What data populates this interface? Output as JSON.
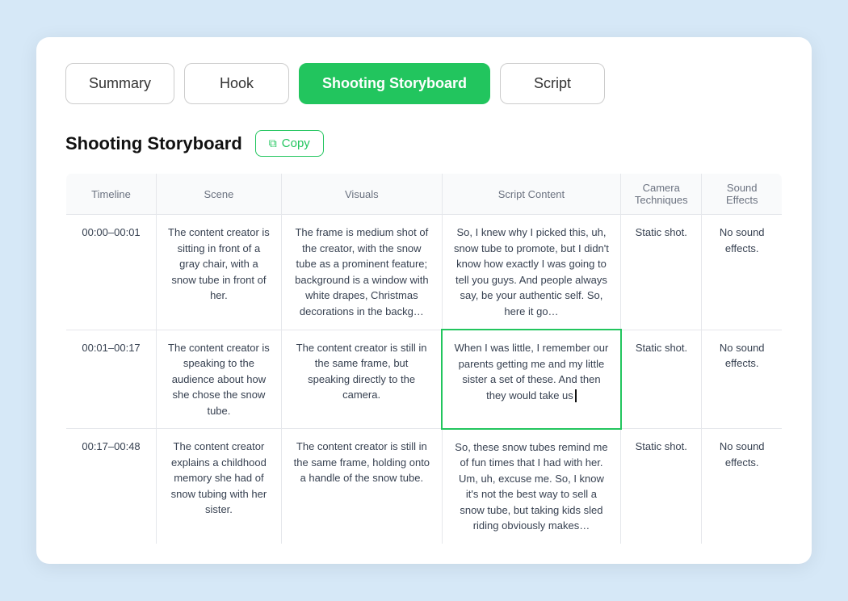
{
  "tabs": [
    {
      "id": "summary",
      "label": "Summary",
      "active": false
    },
    {
      "id": "hook",
      "label": "Hook",
      "active": false
    },
    {
      "id": "shooting-storyboard",
      "label": "Shooting Storyboard",
      "active": true
    },
    {
      "id": "script",
      "label": "Script",
      "active": false
    }
  ],
  "section": {
    "title": "Shooting Storyboard",
    "copy_label": "Copy"
  },
  "table": {
    "headers": [
      "Timeline",
      "Scene",
      "Visuals",
      "Script Content",
      "Camera\nTechniques",
      "Sound\nEffects"
    ],
    "rows": [
      {
        "timeline": "00:00–00:01",
        "scene": "The content creator is sitting in front of a gray chair, with a snow tube in front of her.",
        "visuals": "The frame is medium shot of the creator, with the snow tube as a prominent feature; background is a window with white drapes, Christmas decorations in the backg…",
        "script": "So, I knew why I picked this, uh, snow tube to promote, but I didn't know how exactly I was going to tell you guys. And people always say, be your authentic self. So, here it go…",
        "camera": "Static shot.",
        "sound": "No sound effects.",
        "highlighted": false
      },
      {
        "timeline": "00:01–00:17",
        "scene": "The content creator is speaking to the audience about how she chose the snow tube.",
        "visuals": "The content creator is still in the same frame, but speaking directly to the camera.",
        "script": "When I was little, I remember our parents getting me and my little sister a set of these. And then they would take us",
        "camera": "Static shot.",
        "sound": "No sound effects.",
        "highlighted": true
      },
      {
        "timeline": "00:17–00:48",
        "scene": "The content creator explains a childhood memory she had of snow tubing with her sister.",
        "visuals": "The content creator is still in the same frame, holding onto a handle of the snow tube.",
        "script": "So, these snow tubes remind me of fun times that I had with her. Um, uh, excuse me. So, I know it's not the best way to sell a snow tube, but taking kids sled riding obviously makes…",
        "camera": "Static shot.",
        "sound": "No sound effects.",
        "highlighted": false
      }
    ]
  }
}
